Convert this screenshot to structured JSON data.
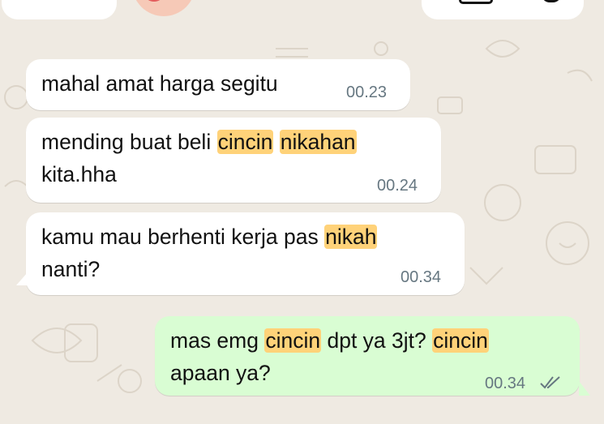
{
  "colors": {
    "background": "#efeae2",
    "incoming_bubble": "#ffffff",
    "outgoing_bubble": "#d9fdd3",
    "highlight": "#ffd279",
    "timestamp": "#667781"
  },
  "header": {
    "back_icon": "chevron-left-icon",
    "video_icon": "video-call-icon",
    "call_icon": "phone-icon"
  },
  "messages": [
    {
      "direction": "incoming",
      "segments": [
        "mahal amat harga segitu"
      ],
      "time": "00.23"
    },
    {
      "direction": "incoming",
      "segments": [
        "mending buat beli ",
        "cincin",
        " ",
        "nikahan",
        "kita.hha"
      ],
      "time": "00.24"
    },
    {
      "direction": "incoming",
      "segments": [
        "kamu mau berhenti kerja pas ",
        "nikah",
        "nanti?"
      ],
      "time": "00.34"
    },
    {
      "direction": "outgoing",
      "segments": [
        "mas emg ",
        "cincin",
        " dpt ya 3jt? ",
        "cincin",
        "apaan ya?"
      ],
      "time": "00.34",
      "status_icon": "read-double-check-icon"
    }
  ]
}
